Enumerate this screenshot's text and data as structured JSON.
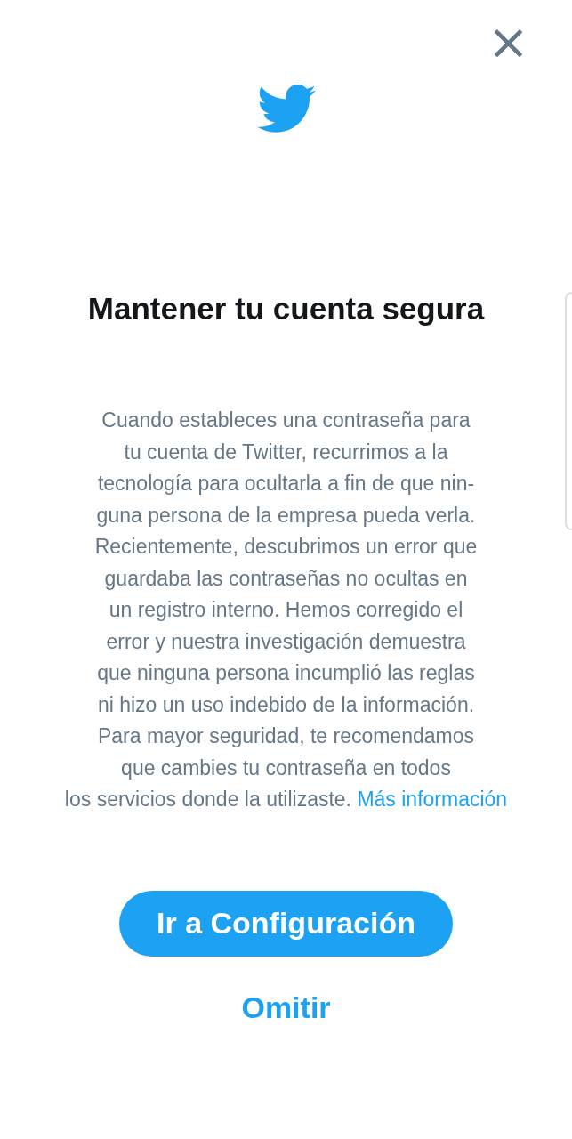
{
  "close_button": {
    "label": "×"
  },
  "title": "Mantener tu cuenta segura",
  "body": {
    "lines": [
      "Cuando estableces una contraseña para",
      "tu cuenta de Twitter, recurrimos a la",
      "tecnología para ocultarla a fin de que nin-",
      "guna persona de la empresa pueda verla.",
      "Recientemente, descubrimos un error que",
      "guardaba las contraseñas no ocultas en",
      "un registro interno. Hemos corregido el",
      "error y nuestra investigación demuestra",
      "que ninguna persona incumplió las reglas",
      "ni hizo un uso indebido de la información.",
      "Para mayor seguridad, te recomendamos",
      "que cambies tu contraseña en todos",
      "los servicios donde la utilizaste."
    ],
    "link": "Más información"
  },
  "primary_button": "Ir a Configuración",
  "secondary_button": "Omitir"
}
